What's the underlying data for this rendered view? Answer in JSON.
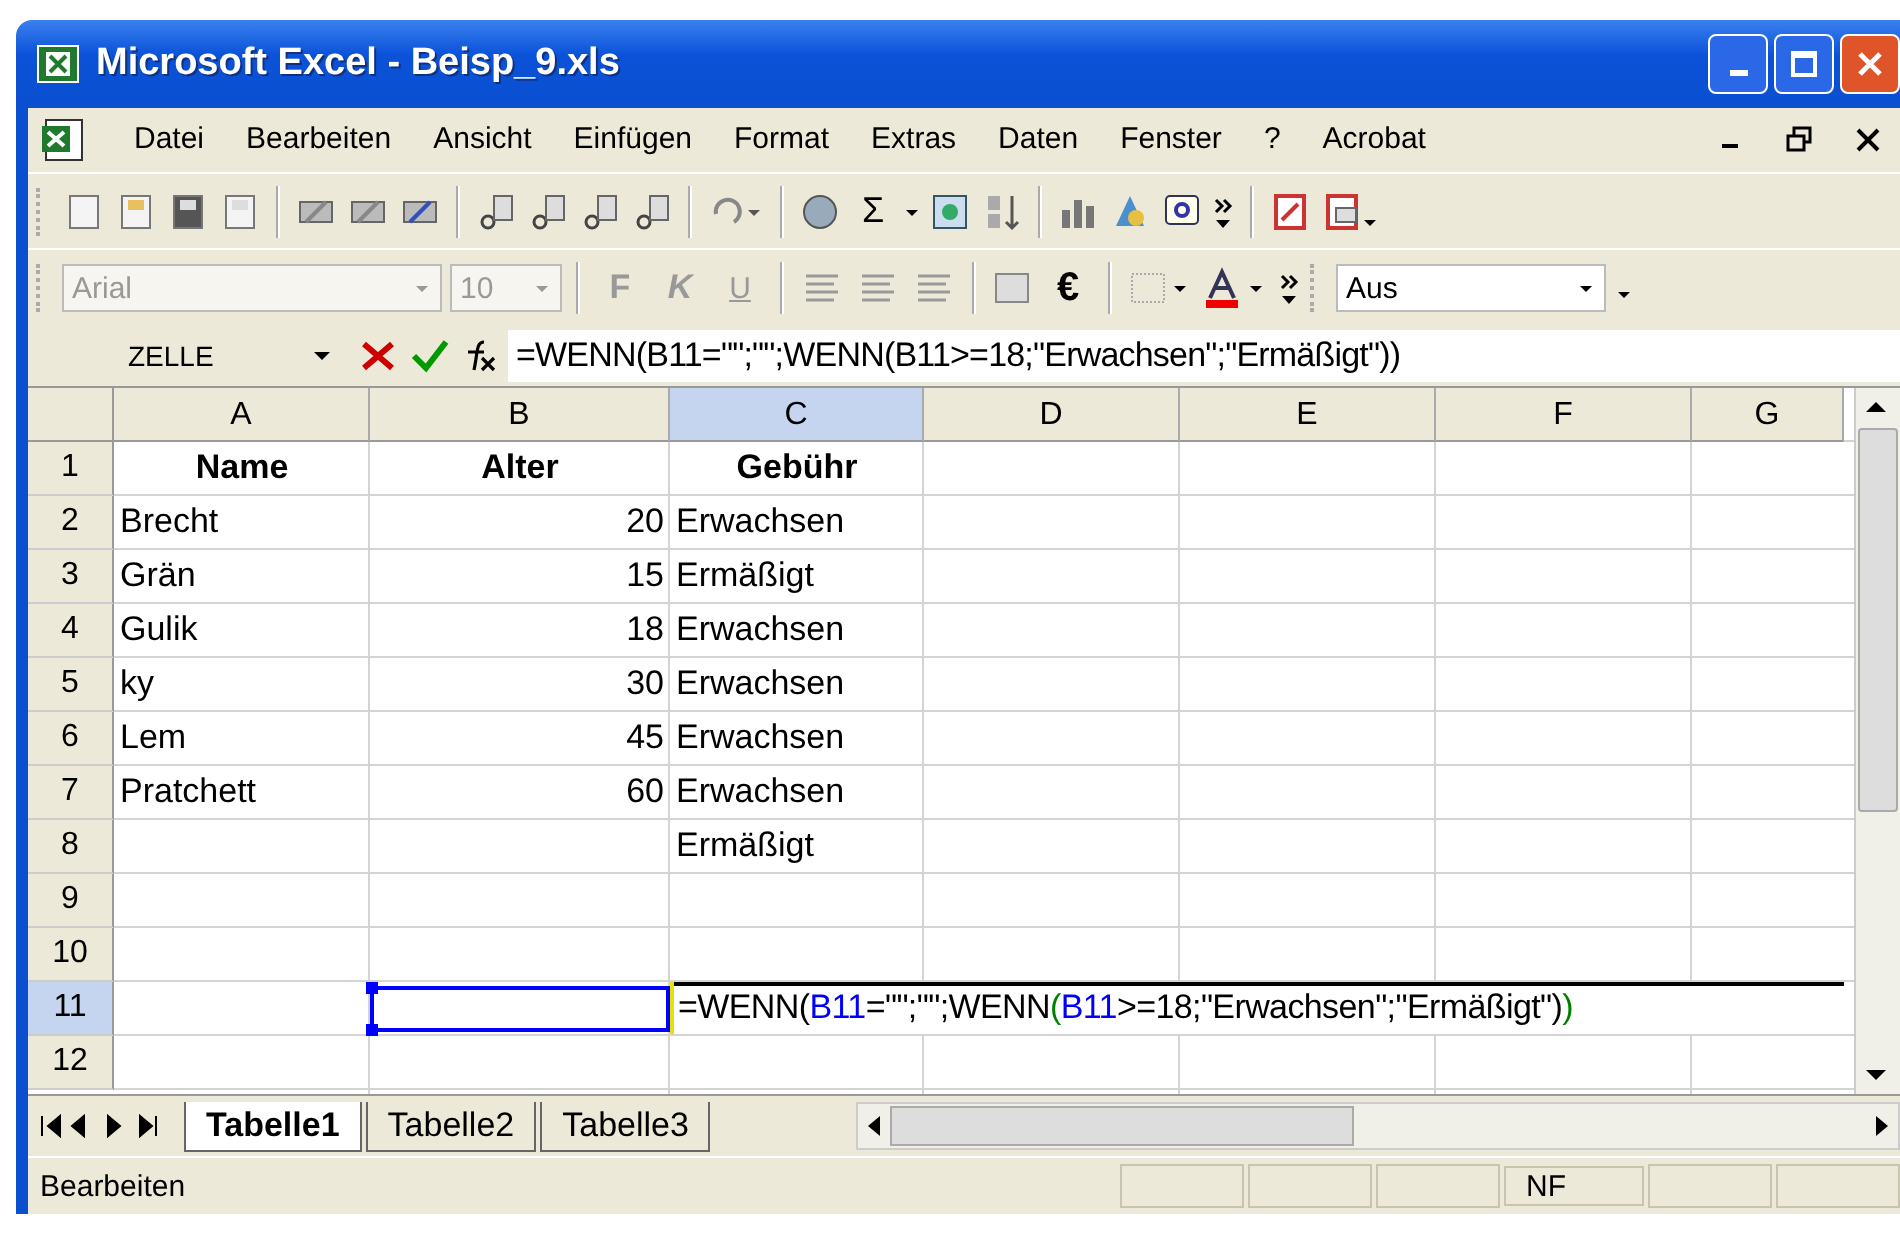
{
  "window": {
    "title": "Microsoft Excel - Beisp_9.xls"
  },
  "menu": [
    "Datei",
    "Bearbeiten",
    "Ansicht",
    "Einfügen",
    "Format",
    "Extras",
    "Daten",
    "Fenster",
    "?",
    "Acrobat"
  ],
  "format_toolbar": {
    "font": "Arial",
    "size": "10",
    "bold": "F",
    "italic": "K",
    "underline": "U",
    "euro": "€",
    "zoom_field": "Aus"
  },
  "standard_toolbar": {
    "sum": "Σ"
  },
  "formula_bar": {
    "name_box": "ZELLE",
    "formula": "=WENN(B11=\"\";\"\";WENN(B11>=18;\"Erwachsen\";\"Ermäßigt\"))"
  },
  "columns": [
    {
      "label": "A",
      "align_right": false,
      "selected": false
    },
    {
      "label": "B",
      "align_right": true,
      "selected": false
    },
    {
      "label": "C",
      "align_right": false,
      "selected": true
    },
    {
      "label": "D",
      "selected": false
    },
    {
      "label": "E",
      "selected": false
    },
    {
      "label": "F",
      "selected": false
    },
    {
      "label": "G",
      "selected": false
    }
  ],
  "rows": [
    {
      "label": "1",
      "kind": "header",
      "selected": false,
      "cells": [
        "Name",
        "Alter",
        "Gebühr"
      ]
    },
    {
      "label": "2",
      "kind": "data",
      "selected": false,
      "cells": [
        "Brecht",
        "20",
        "Erwachsen"
      ]
    },
    {
      "label": "3",
      "kind": "data",
      "selected": false,
      "cells": [
        "Grän",
        "15",
        "Ermäßigt"
      ]
    },
    {
      "label": "4",
      "kind": "data",
      "selected": false,
      "cells": [
        "Gulik",
        "18",
        "Erwachsen"
      ]
    },
    {
      "label": "5",
      "kind": "data",
      "selected": false,
      "cells": [
        "ky",
        "30",
        "Erwachsen"
      ]
    },
    {
      "label": "6",
      "kind": "data",
      "selected": false,
      "cells": [
        "Lem",
        "45",
        "Erwachsen"
      ]
    },
    {
      "label": "7",
      "kind": "data",
      "selected": false,
      "cells": [
        "Pratchett",
        "60",
        "Erwachsen"
      ]
    },
    {
      "label": "8",
      "kind": "data",
      "selected": false,
      "cells": [
        "",
        "",
        "Ermäßigt"
      ]
    },
    {
      "label": "9",
      "kind": "data",
      "selected": false,
      "cells": []
    },
    {
      "label": "10",
      "kind": "data",
      "selected": false,
      "cells": []
    },
    {
      "label": "11",
      "kind": "data",
      "selected": true,
      "cells": [
        "",
        {
          "color": "#0000ff"
        },
        {
          "segments": [
            {
              "text": "=WENN(",
              "color": "#000000"
            },
            {
              "text": "B11",
              "color": "#0000ff"
            },
            {
              "text": "=\"\";\"\";WENN",
              "color": "#000000"
            },
            {
              "text": "(",
              "color": "#008000"
            },
            {
              "text": "B11",
              "color": "#0000ff"
            },
            {
              "text": ">=18;\"Erwachsen\";\"Ermäßigt\")",
              "color": "#000000"
            },
            {
              "text": ")",
              "color": "#008000"
            }
          ]
        }
      ]
    },
    {
      "label": "12",
      "kind": "data",
      "selected": false,
      "cells": []
    }
  ],
  "sheet_tabs": [
    {
      "label": "Tabelle1",
      "selected": true
    },
    {
      "label": "Tabelle2",
      "selected": false
    },
    {
      "label": "Tabelle3",
      "selected": false
    }
  ],
  "status_bar": {
    "mode": "Bearbeiten",
    "indicator": "NF"
  }
}
